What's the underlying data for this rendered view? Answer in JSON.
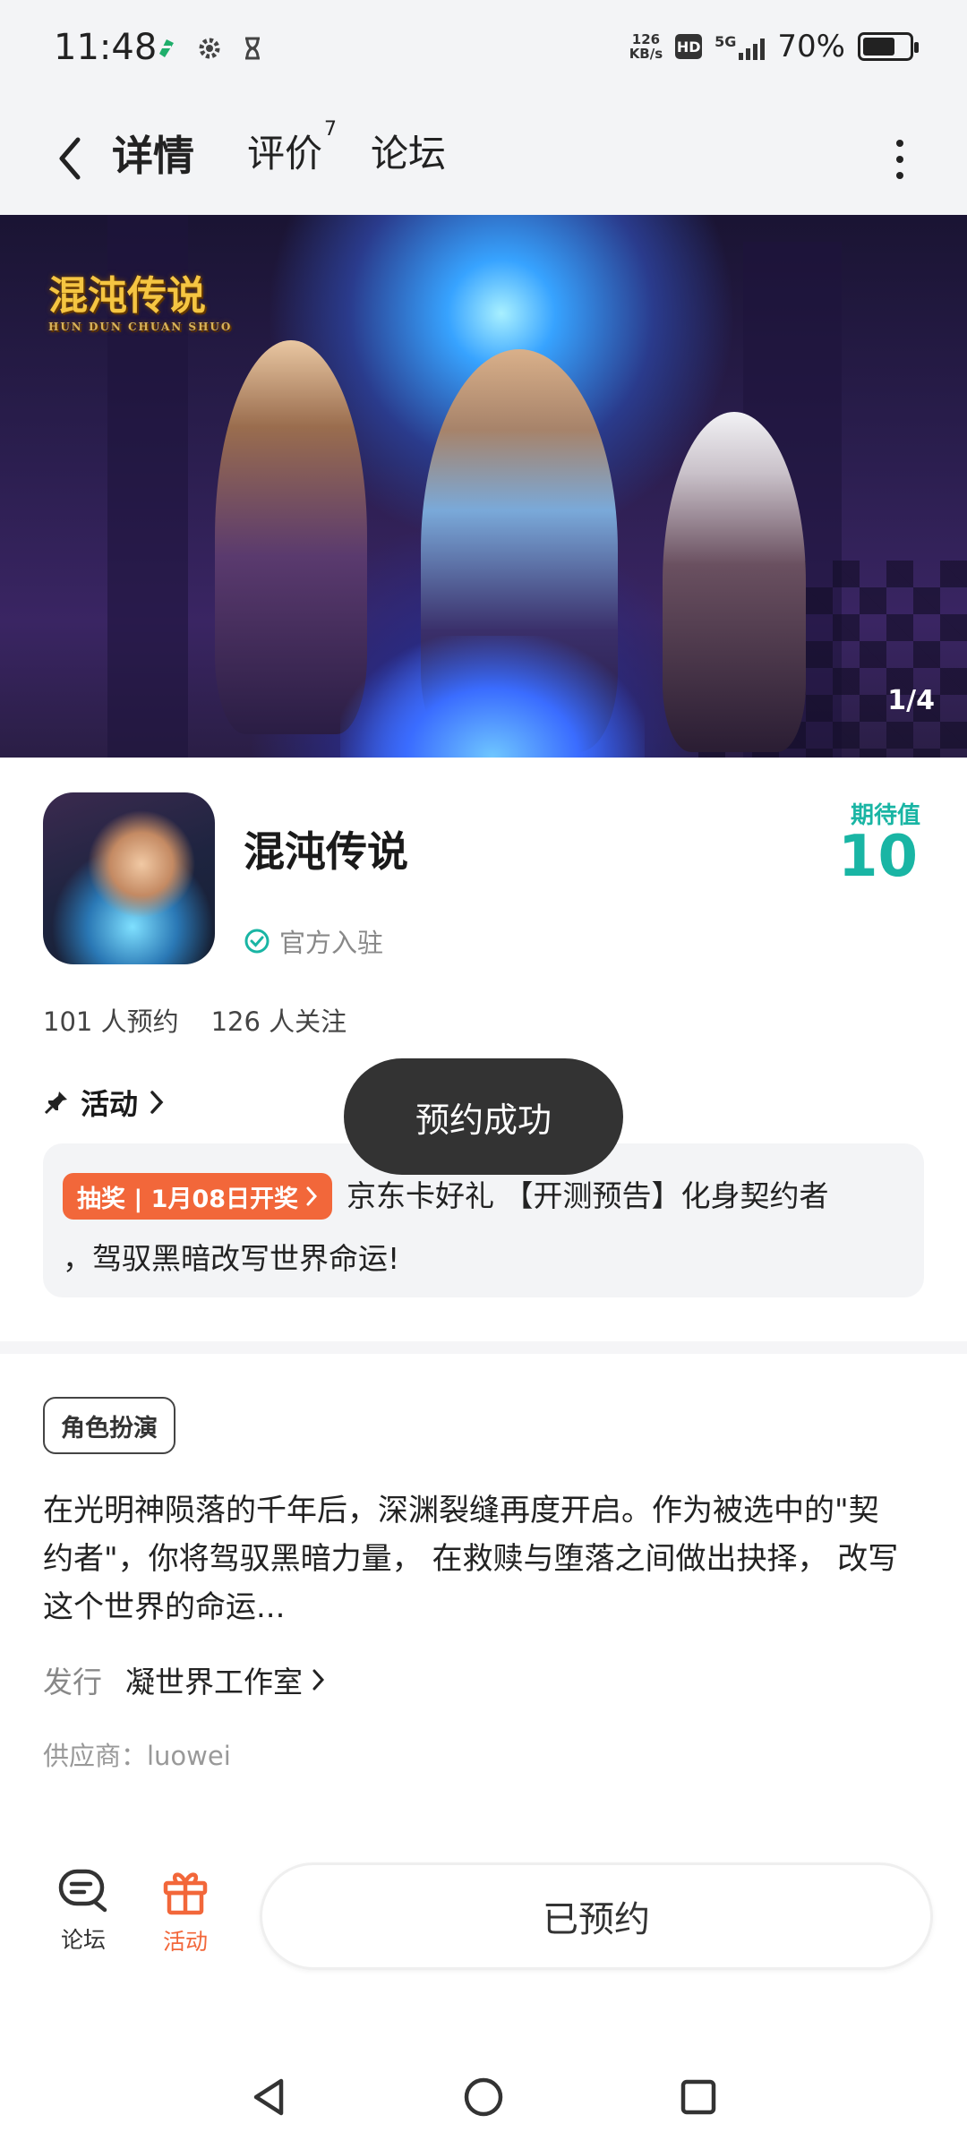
{
  "status_bar": {
    "time": "11:48",
    "net_speed_value": "126",
    "net_speed_unit": "KB/s",
    "hd": "HD",
    "network": "5G",
    "battery_percent": "70%",
    "battery_level": 0.7
  },
  "nav": {
    "tabs": [
      {
        "label": "详情"
      },
      {
        "label": "评价",
        "badge": "7"
      },
      {
        "label": "论坛"
      }
    ]
  },
  "banner": {
    "logo_text": "混沌传说",
    "logo_sub": "HUN DUN CHUAN SHUO",
    "counter": "1/4"
  },
  "game": {
    "name": "混沌传说",
    "official_label": "官方入驻",
    "expect_label": "期待值",
    "expect_value": "10",
    "reservations": "101 人预约",
    "followers": "126 人关注"
  },
  "activity": {
    "heading": "活动",
    "tag": "抽奖 | 1月08日开奖",
    "text_line1": "京东卡好礼 【开测预告】化身契约者",
    "text_line2": "，驾驭黑暗改写世界命运!"
  },
  "toast": "预约成功",
  "details": {
    "genre": "角色扮演",
    "description": "在光明神陨落的千年后，深渊裂缝再度开启。作为被选中的\"契约者\"，你将驾驭黑暗力量， 在救赎与堕落之间做出抉择， 改写这个世界的命运...",
    "publisher_label": "发行",
    "publisher_name": "凝世界工作室",
    "supplier": "供应商：luowei"
  },
  "bottom_bar": {
    "forum_label": "论坛",
    "activity_label": "活动",
    "reserved_label": "已预约"
  },
  "colors": {
    "accent_teal": "#19b5a4",
    "accent_orange": "#f2673a"
  }
}
